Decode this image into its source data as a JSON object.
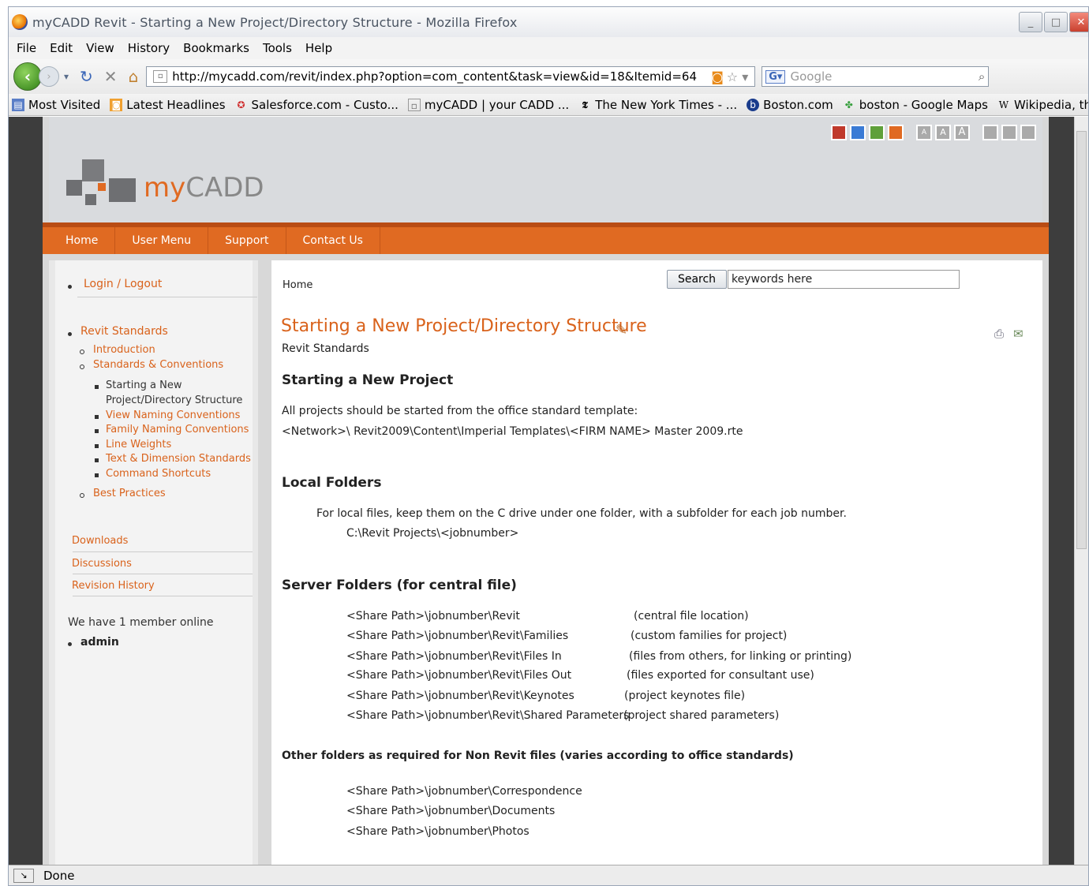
{
  "window": {
    "title": "myCADD Revit - Starting a New Project/Directory Structure - Mozilla Firefox"
  },
  "menu": [
    "File",
    "Edit",
    "View",
    "History",
    "Bookmarks",
    "Tools",
    "Help"
  ],
  "url": "http://mycadd.com/revit/index.php?option=com_content&task=view&id=18&Itemid=64",
  "google_placeholder": "Google",
  "bookmarks": [
    {
      "icon": "most-visited-icon",
      "label": "Most Visited"
    },
    {
      "icon": "rss-icon",
      "label": "Latest Headlines"
    },
    {
      "icon": "salesforce-icon",
      "label": "Salesforce.com - Custo..."
    },
    {
      "icon": "page-icon",
      "label": "myCADD | your CADD ..."
    },
    {
      "icon": "nyt-icon",
      "label": "The New York Times - ..."
    },
    {
      "icon": "boston-icon",
      "label": "Boston.com"
    },
    {
      "icon": "maps-icon",
      "label": "boston - Google Maps"
    },
    {
      "icon": "wikipedia-icon",
      "label": "Wikipedia, the free enc..."
    }
  ],
  "site": {
    "logo_prefix": "my",
    "logo_suffix": "CADD",
    "swatch_colors": [
      "#c0392b",
      "#3a7bd5",
      "#5fa03a",
      "#e06a22"
    ],
    "nav": [
      "Home",
      "User Menu",
      "Support",
      "Contact Us"
    ]
  },
  "sidebar": {
    "login": "Login / Logout",
    "revit_standards": "Revit Standards",
    "introduction": "Introduction",
    "standards_conventions": "Standards & Conventions",
    "current_line1": "Starting a New",
    "current_line2": "Project/Directory Structure",
    "sub_items": [
      "View Naming Conventions",
      "Family Naming Conventions",
      "Line Weights",
      "Text & Dimension Standards",
      "Command Shortcuts"
    ],
    "best_practices": "Best Practices",
    "links": [
      "Downloads",
      "Discussions",
      "Revision History"
    ],
    "online_text": "We have 1 member online",
    "online_user": "admin"
  },
  "content": {
    "breadcrumb": "Home",
    "search_button": "Search",
    "search_value": "keywords here",
    "title": "Starting a New Project/Directory Structure",
    "category": "Revit Standards",
    "h_start": "Starting a New Project",
    "p_start": "All projects should be started from the office standard template:",
    "p_template": "<Network>\\ Revit2009\\Content\\Imperial Templates\\<FIRM NAME> Master 2009.rte",
    "h_local": "Local Folders",
    "p_local": "For local files, keep them on the C drive under one folder, with a subfolder for each job number.",
    "p_local_path": "C:\\Revit Projects\\<jobnumber>",
    "h_server": "Server Folders (for central file)",
    "server_rows": [
      {
        "path": "<Share Path>\\jobnumber\\Revit",
        "desc": "(central file location)"
      },
      {
        "path": "<Share Path>\\jobnumber\\Revit\\Families",
        "desc": "(custom families for project)"
      },
      {
        "path": "<Share Path>\\jobnumber\\Revit\\Files In",
        "desc": "(files from others, for linking or printing)"
      },
      {
        "path": "<Share Path>\\jobnumber\\Revit\\Files Out",
        "desc": "(files exported for consultant use)"
      },
      {
        "path": "<Share Path>\\jobnumber\\Revit\\Keynotes",
        "desc": "(project keynotes file)"
      },
      {
        "path": "<Share Path>\\jobnumber\\Revit\\Shared Parameters",
        "desc": "(project shared parameters)"
      }
    ],
    "h_other": "Other folders as required for Non Revit files (varies according to office standards)",
    "other_rows": [
      "<Share Path>\\jobnumber\\Correspondence",
      "<Share Path>\\jobnumber\\Documents",
      "<Share Path>\\jobnumber\\Photos"
    ]
  },
  "status": "Done"
}
